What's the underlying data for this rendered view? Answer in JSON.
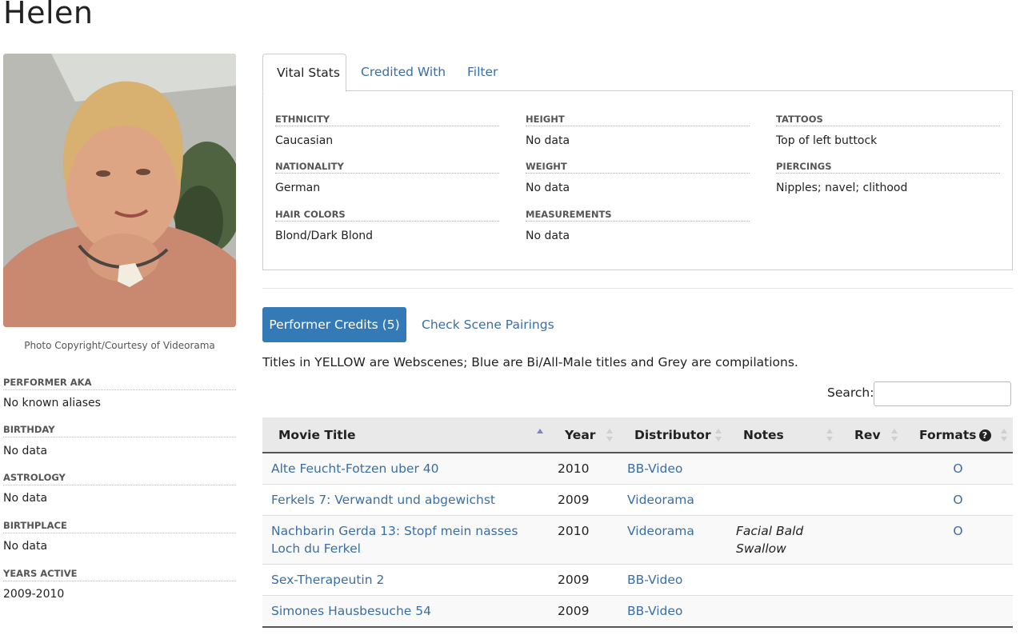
{
  "performer": {
    "name": "Helen",
    "photo_caption": "Photo Copyright/Courtesy of Videorama"
  },
  "sidebar": {
    "aka_label": "PERFORMER AKA",
    "aka_value": "No known aliases",
    "birthday_label": "BIRTHDAY",
    "birthday_value": "No data",
    "astrology_label": "ASTROLOGY",
    "astrology_value": "No data",
    "birthplace_label": "BIRTHPLACE",
    "birthplace_value": "No data",
    "years_label": "YEARS ACTIVE",
    "years_value": "2009-2010"
  },
  "tabs": {
    "vital_stats": "Vital Stats",
    "credited_with": "Credited With",
    "filter": "Filter"
  },
  "vitals": {
    "ethnicity_label": "ETHNICITY",
    "ethnicity": "Caucasian",
    "nationality_label": "NATIONALITY",
    "nationality": "German",
    "hair_label": "HAIR COLORS",
    "hair": "Blond/Dark Blond",
    "height_label": "HEIGHT",
    "height": "No data",
    "weight_label": "WEIGHT",
    "weight": "No data",
    "measurements_label": "MEASUREMENTS",
    "measurements": "No data",
    "tattoos_label": "TATTOOS",
    "tattoos": "Top of left buttock",
    "piercings_label": "PIERCINGS",
    "piercings": "Nipples; navel; clithood"
  },
  "credits": {
    "button_label": "Performer Credits (5)",
    "pairings_label": "Check Scene Pairings",
    "legend": "Titles in YELLOW are Webscenes; Blue are Bi/All-Male titles and Grey are compilations.",
    "search_label": "Search:",
    "search_value": "",
    "columns": {
      "title": "Movie Title",
      "year": "Year",
      "distributor": "Distributor",
      "notes": "Notes",
      "rev": "Rev",
      "formats": "Formats"
    },
    "rows": [
      {
        "title": "Alte Feucht-Fotzen uber 40",
        "year": "2010",
        "distributor": "BB-Video",
        "notes": "",
        "rev": "",
        "formats": "O"
      },
      {
        "title": "Ferkels 7: Verwandt und abgewichst",
        "year": "2009",
        "distributor": "Videorama",
        "notes": "",
        "rev": "",
        "formats": "O"
      },
      {
        "title": "Nachbarin Gerda 13: Stopf mein nasses Loch du Ferkel",
        "year": "2010",
        "distributor": "Videorama",
        "notes": "Facial Bald Swallow",
        "rev": "",
        "formats": "O"
      },
      {
        "title": "Sex-Therapeutin 2",
        "year": "2009",
        "distributor": "BB-Video",
        "notes": "",
        "rev": "",
        "formats": ""
      },
      {
        "title": "Simones Hausbesuche 54",
        "year": "2009",
        "distributor": "BB-Video",
        "notes": "",
        "rev": "",
        "formats": ""
      }
    ]
  },
  "colors": {
    "link": "#3a6ea5",
    "primary_button": "#337ab7",
    "header_bg": "#e9e9e9"
  }
}
